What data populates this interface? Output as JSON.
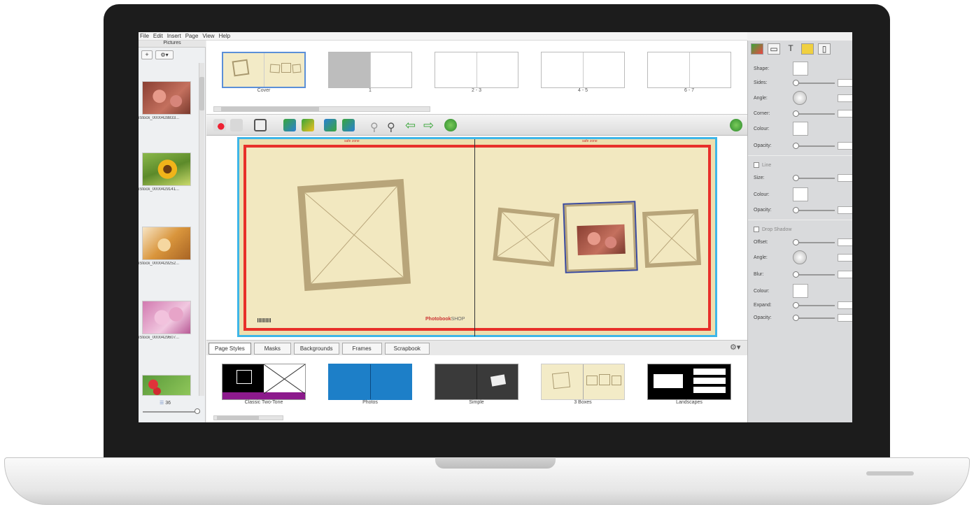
{
  "menu": [
    "File",
    "Edit",
    "Insert",
    "Page",
    "View",
    "Help"
  ],
  "pictures": {
    "title": "Pictures",
    "add_label": "+",
    "settings_label": "⚙▾",
    "items": [
      {
        "caption": "iStock_0000428833..."
      },
      {
        "caption": "iStock_0000429141..."
      },
      {
        "caption": "iStock_0000429252..."
      },
      {
        "caption": "iStock_0000429607..."
      }
    ],
    "count_label": "36"
  },
  "page_strip": [
    "Cover",
    "1",
    "2 - 3",
    "4 - 5",
    "6 - 7"
  ],
  "tabs": [
    "Page Styles",
    "Masks",
    "Backgrounds",
    "Frames",
    "Scrapbook"
  ],
  "page_styles": [
    "Classic Two-Tone",
    "Photos",
    "Simple",
    "3 Boxes",
    "Landscapes"
  ],
  "canvas": {
    "brand_text": "Photobook",
    "brand_suffix": "SHOP",
    "top_label_left": "safe zone",
    "top_label_right": "safe zone"
  },
  "properties": {
    "tabs": [
      "image",
      "frame",
      "text",
      "tag",
      "page"
    ],
    "shape_labels": [
      "Shape:",
      "Sides:",
      "Angle:",
      "Corner:",
      "Colour:",
      "Opacity:"
    ],
    "line_toggle": "Line",
    "line_labels": [
      "Size:",
      "Colour:",
      "Opacity:"
    ],
    "shadow_toggle": "Drop Shadow",
    "shadow_labels": [
      "Offset:",
      "Angle:",
      "Blur:",
      "Colour:",
      "Expand:",
      "Opacity:"
    ]
  },
  "colors": {
    "page_cream": "#f2e8c0",
    "bleed_red": "#e8302a",
    "safe_blue": "#3eb6e8",
    "accent_green": "#3aa63a"
  }
}
